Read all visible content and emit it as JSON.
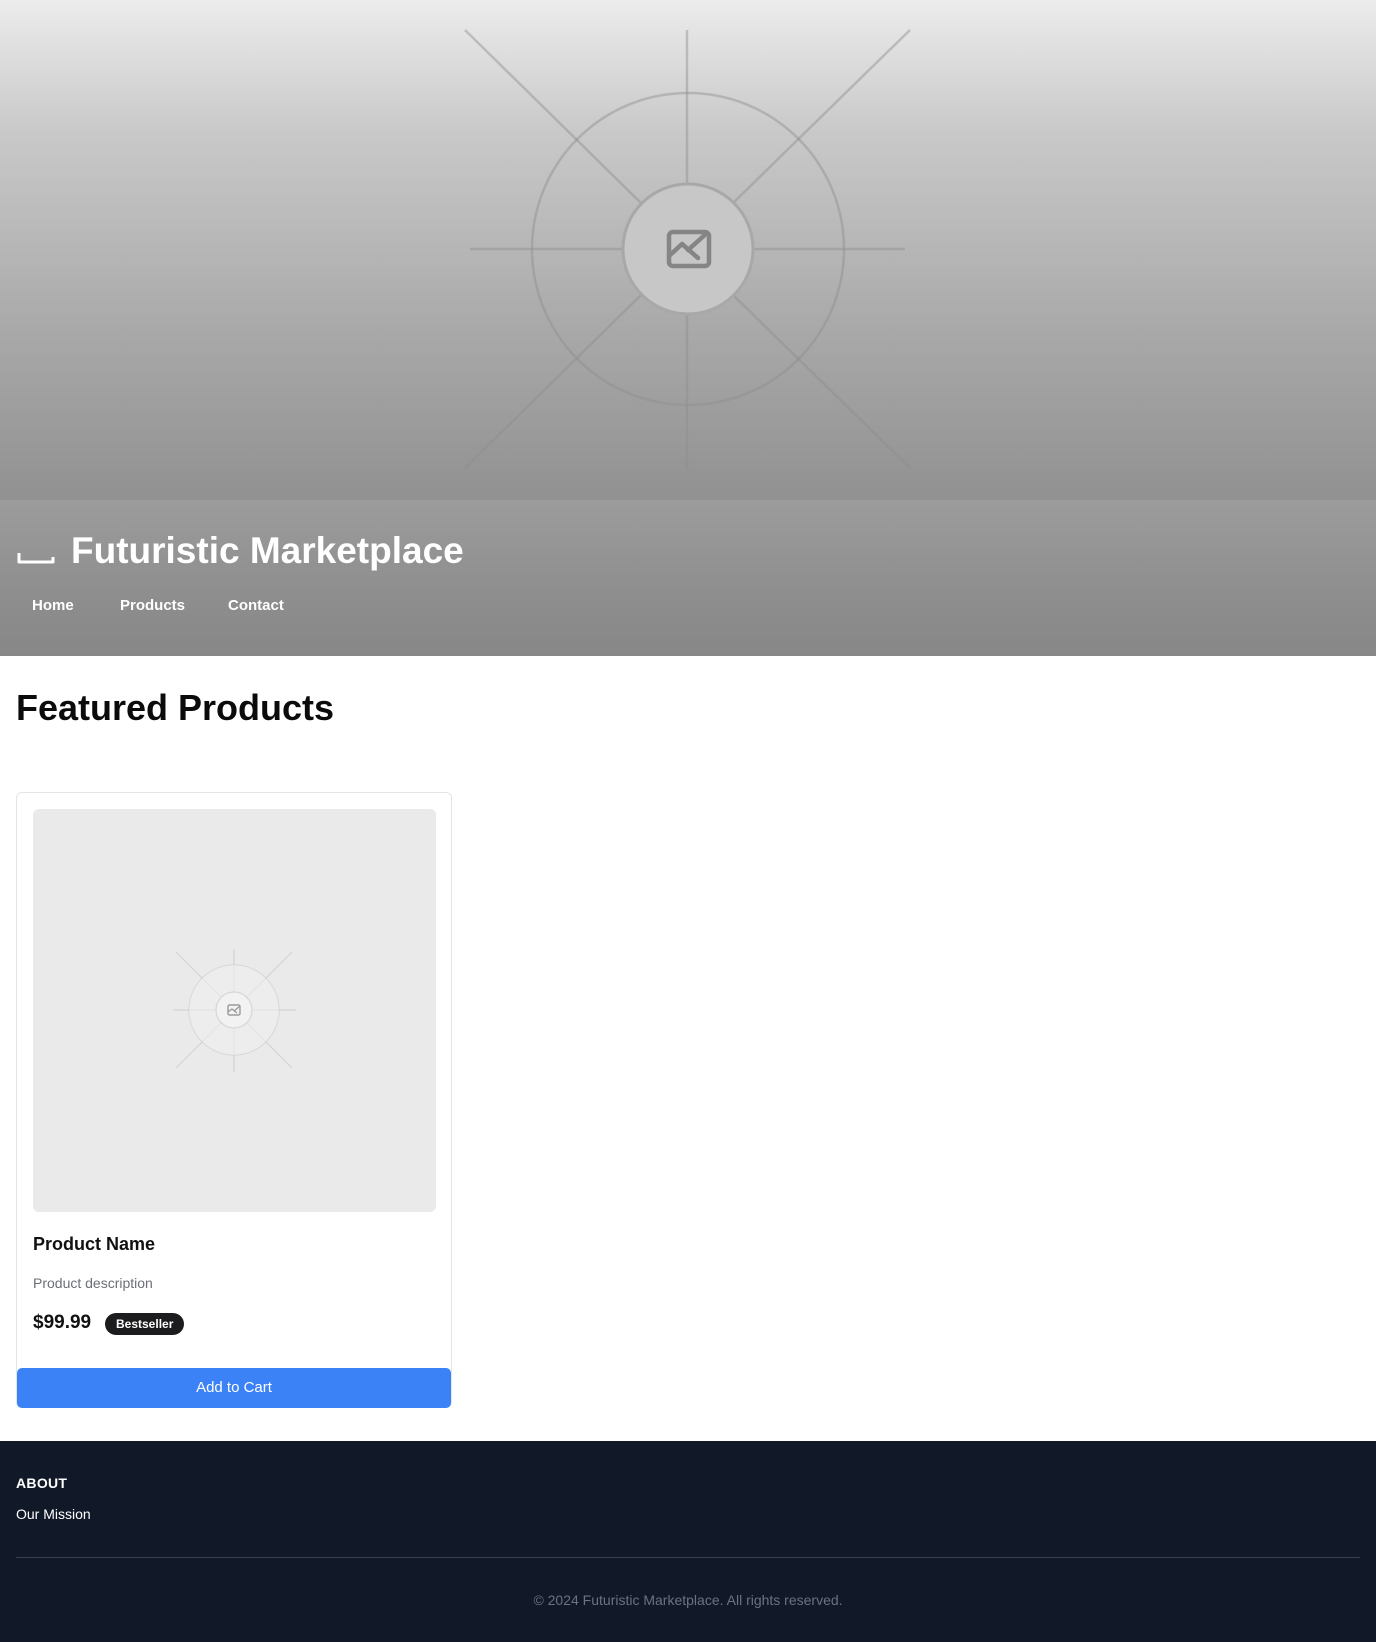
{
  "header": {
    "site_title": "Futuristic Marketplace",
    "logo_icon": "underscore-logo-icon",
    "nav": [
      {
        "label": "Home"
      },
      {
        "label": "Products"
      },
      {
        "label": "Contact"
      }
    ],
    "hero_icon": "image-placeholder-icon"
  },
  "main": {
    "section_title": "Featured Products",
    "products": [
      {
        "image_icon": "image-placeholder-icon",
        "name": "Product Name",
        "description": "Product description",
        "price": "$99.99",
        "badge": "Bestseller",
        "button_label": "Add to Cart"
      }
    ]
  },
  "footer": {
    "about_heading": "ABOUT",
    "about_link": "Our Mission",
    "copyright": "© 2024 Futuristic Marketplace. All rights reserved."
  },
  "colors": {
    "accent": "#3b82f6",
    "footer_bg": "#111827",
    "badge_bg": "#1c1c1e"
  }
}
